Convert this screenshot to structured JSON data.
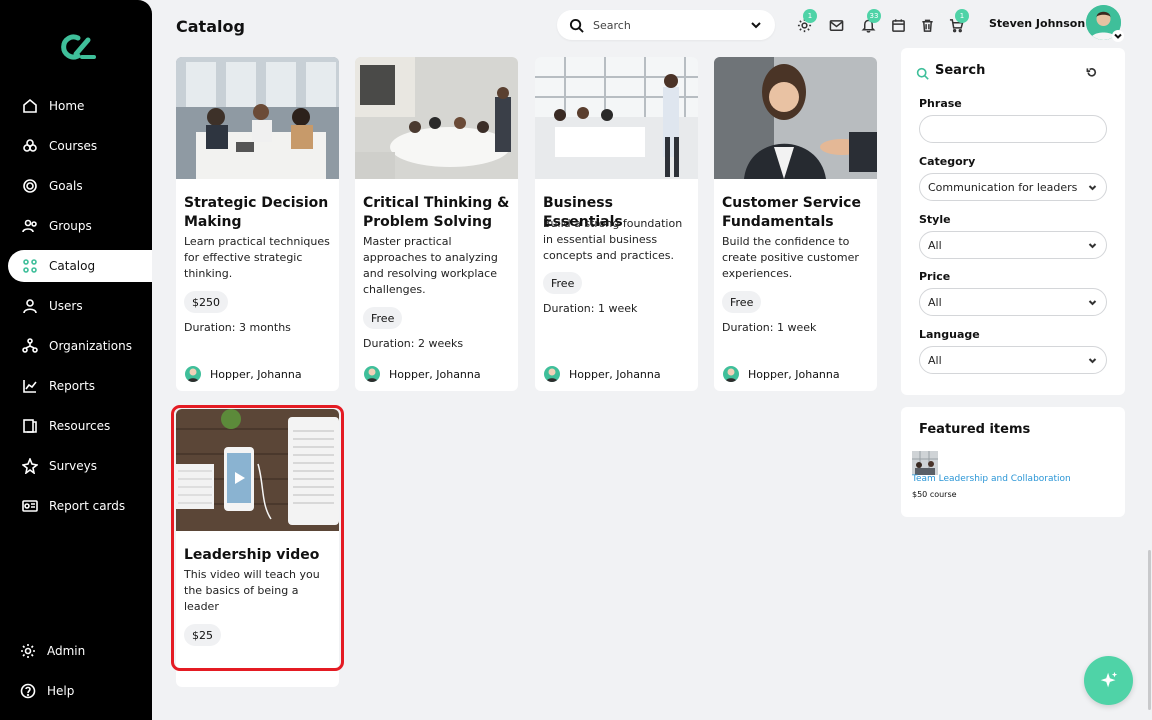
{
  "sidebar": {
    "nav": [
      {
        "label": "Home",
        "icon": "home-icon"
      },
      {
        "label": "Courses",
        "icon": "courses-icon"
      },
      {
        "label": "Goals",
        "icon": "goals-icon"
      },
      {
        "label": "Groups",
        "icon": "groups-icon"
      },
      {
        "label": "Catalog",
        "icon": "catalog-icon",
        "active": true
      },
      {
        "label": "Users",
        "icon": "users-icon"
      },
      {
        "label": "Organizations",
        "icon": "organizations-icon"
      },
      {
        "label": "Reports",
        "icon": "reports-icon"
      },
      {
        "label": "Resources",
        "icon": "resources-icon"
      },
      {
        "label": "Surveys",
        "icon": "surveys-icon"
      },
      {
        "label": "Report cards",
        "icon": "report-cards-icon"
      }
    ],
    "bottom": [
      {
        "label": "Admin",
        "icon": "gear-icon"
      },
      {
        "label": "Help",
        "icon": "help-icon"
      }
    ]
  },
  "header": {
    "title": "Catalog",
    "search_placeholder": "Search",
    "badges": {
      "settings": "1",
      "notifications": "33",
      "cart": "1"
    },
    "user_name": "Steven Johnson"
  },
  "cards": [
    {
      "title": "Strategic Decision Making",
      "desc": "Learn practical techniques for effective strategic thinking.",
      "price": "$250",
      "duration": "Duration: 3 months",
      "author": "Hopper, Johanna"
    },
    {
      "title": "Critical Thinking & Problem Solving",
      "desc": "Master practical approaches to analyzing and resolving workplace challenges.",
      "price": "Free",
      "duration": "Duration: 2 weeks",
      "author": "Hopper, Johanna"
    },
    {
      "title": "Business Essentials",
      "desc": "Build a strong foundation in essential business concepts and practices.",
      "price": "Free",
      "duration": "Duration: 1 week",
      "author": "Hopper, Johanna"
    },
    {
      "title": "Customer Service Fundamentals",
      "desc": "Build the confidence to create positive customer experiences.",
      "price": "Free",
      "duration": "Duration: 1 week",
      "author": "Hopper, Johanna"
    },
    {
      "title": "Leadership video",
      "desc": "This video will teach you the basics of being a leader",
      "price": "$25"
    }
  ],
  "search_panel": {
    "title": "Search",
    "phrase_label": "Phrase",
    "phrase_value": "",
    "category_label": "Category",
    "category_value": "Communication for leaders",
    "style_label": "Style",
    "style_value": "All",
    "price_label": "Price",
    "price_value": "All",
    "language_label": "Language",
    "language_value": "All"
  },
  "featured": {
    "title": "Featured items",
    "item_title": "Team Leadership and Collaboration",
    "item_price": "$50 course"
  },
  "colors": {
    "accent": "#3fbf9a",
    "badge": "#4fd3a7",
    "highlight": "#e41b23",
    "link": "#2b96d6"
  }
}
